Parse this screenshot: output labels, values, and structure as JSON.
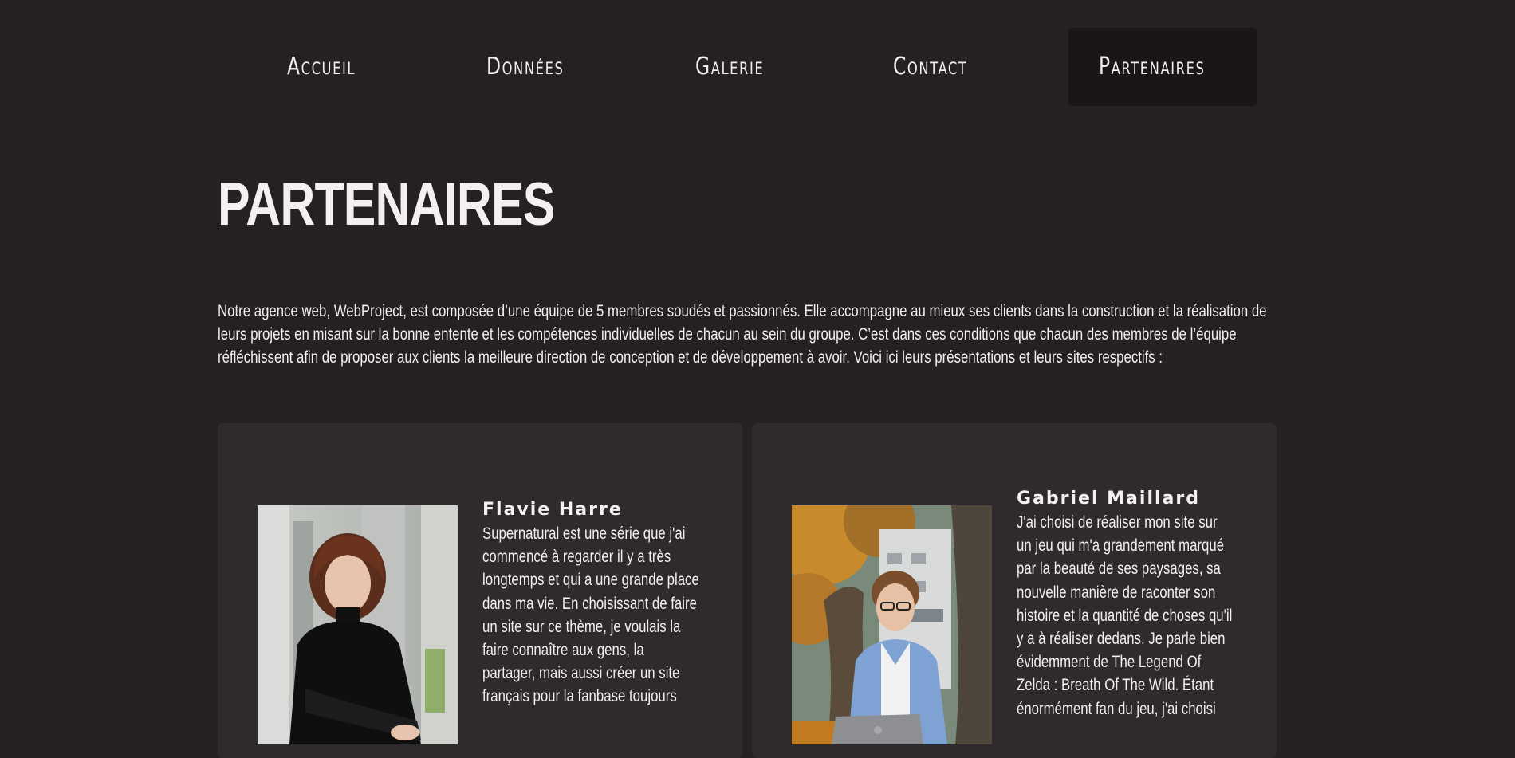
{
  "nav": {
    "items": [
      {
        "label": "Accueil"
      },
      {
        "label": "Données"
      },
      {
        "label": "Galerie"
      },
      {
        "label": "Contact"
      },
      {
        "label": "Partenaires",
        "active": true
      }
    ]
  },
  "page": {
    "title": "PARTENAIRES",
    "intro": "Notre agence web, WebProject, est composée d’une équipe de 5 membres soudés et passionnés. Elle accompagne au mieux ses clients dans la construction et la réalisation de leurs projets en misant sur la bonne entente et les compétences individuelles de chacun au sein du groupe. C’est dans ces conditions que chacun des membres de l’équipe réfléchissent afin de proposer aux clients la meilleure direction de conception et de développement à avoir. Voici ici leurs présentations et leurs sites respectifs :"
  },
  "members": [
    {
      "name": "Flavie Harre",
      "bio": "Supernatural est une série que j'ai commencé à regarder il y a très longtemps et qui a une grande place dans ma vie. En choisissant de faire un site sur ce thème, je voulais la faire connaître aux gens, la partager, mais aussi créer un site français pour la fanbase toujours"
    },
    {
      "name": "Gabriel Maillard",
      "bio": "J'ai choisi de réaliser mon site sur un jeu qui m'a grandement marqué par la beauté de ses paysages, sa nouvelle manière de raconter son histoire et la quantité de choses qu'il y a à réaliser dedans. Je parle bien évidemment de The Legend Of Zelda : Breath Of The Wild. Étant énormément fan du jeu, j'ai choisi"
    }
  ],
  "colors": {
    "background": "#252123",
    "card": "#2f2a2d",
    "nav_active": "#1a1617",
    "text": "#f3eef0"
  }
}
